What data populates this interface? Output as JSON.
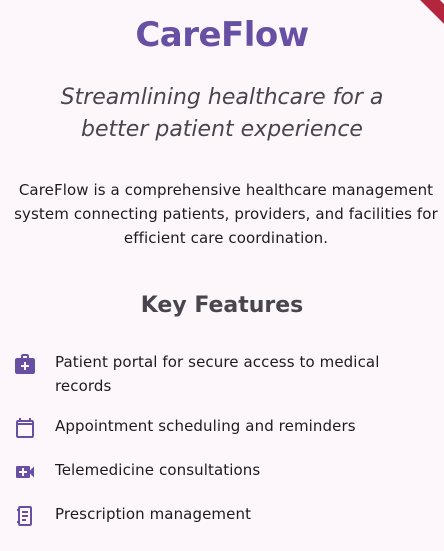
{
  "app": {
    "title": "CareFlow",
    "tagline": "Streamlining healthcare for a better patient experience",
    "description": "CareFlow is a comprehensive healthcare management system connecting patients, providers, and facilities for efficient care coordination."
  },
  "features": {
    "heading": "Key Features",
    "items": [
      {
        "icon": "medical-bag-icon",
        "label": "Patient portal for secure access to medical records"
      },
      {
        "icon": "calendar-icon",
        "label": "Appointment scheduling and reminders"
      },
      {
        "icon": "video-call-icon",
        "label": "Telemedicine consultations"
      },
      {
        "icon": "receipt-icon",
        "label": "Prescription management"
      }
    ]
  },
  "colors": {
    "background": "#fdf7fc",
    "primary": "#6750a4",
    "secondary_text": "#49454f",
    "body_text": "#1d1b20",
    "debug_ribbon": "#b3263e"
  }
}
